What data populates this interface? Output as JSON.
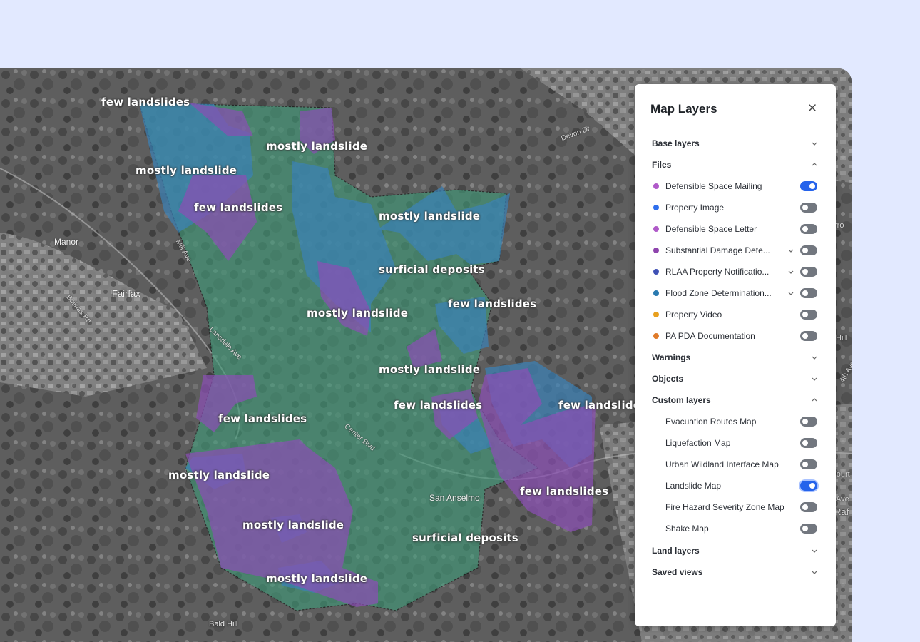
{
  "colors": {
    "accent": "#2563eb",
    "zone_green": "#3f9a78",
    "zone_blue": "#3a82b8",
    "zone_purple": "#8a4fb4"
  },
  "map": {
    "zone_labels": [
      "few landslides",
      "mostly landslide",
      "mostly landslide",
      "few landslides",
      "mostly landslide",
      "surficial deposits",
      "mostly landslide",
      "few landslides",
      "mostly landslide",
      "few landslides",
      "few landslides",
      "few landslides",
      "mostly landslide",
      "few landslides",
      "mostly landslide",
      "surficial deposits",
      "mostly landslide"
    ],
    "place_labels": [
      "Manor",
      "Fairfax",
      "San Anselmo",
      "Bald Hill"
    ],
    "street_labels": [
      "Center Blvd",
      "Lansdale Ave",
      "Bolinas Rd",
      "Mill Ave",
      "Devon Dr",
      "rro",
      "Hill",
      "4th Ave",
      "Fourt",
      "Ave",
      "Raf"
    ]
  },
  "panel": {
    "title": "Map Layers",
    "close_icon": "close-icon",
    "sections": {
      "base_layers": "Base layers",
      "files": "Files",
      "warnings": "Warnings",
      "objects": "Objects",
      "custom_layers": "Custom layers",
      "land_layers": "Land layers",
      "saved_views": "Saved views"
    },
    "files": [
      {
        "label": "Defensible Space Mailing",
        "color": "#b05ac9",
        "on": true
      },
      {
        "label": "Property Image",
        "color": "#2f6fed",
        "on": false
      },
      {
        "label": "Defensible Space Letter",
        "color": "#b05ac9",
        "on": false
      },
      {
        "label": "Substantial Damage Dete...",
        "color": "#8e44ad",
        "on": false
      },
      {
        "label": "RLAA Property Notificatio...",
        "color": "#3f51b5",
        "on": false
      },
      {
        "label": "Flood Zone Determination...",
        "color": "#2a7ab0",
        "on": false
      },
      {
        "label": "Property Video",
        "color": "#e8a01e",
        "on": false
      },
      {
        "label": "PA PDA Documentation",
        "color": "#e07b2a",
        "on": false
      }
    ],
    "custom_layers": [
      {
        "label": "Evacuation Routes Map",
        "on": false
      },
      {
        "label": "Liquefaction Map",
        "on": false
      },
      {
        "label": "Urban Wildland Interface Map",
        "on": false
      },
      {
        "label": "Landslide Map",
        "on": true
      },
      {
        "label": "Fire Hazard Severity Zone Map",
        "on": false
      },
      {
        "label": "Shake Map",
        "on": false
      }
    ]
  }
}
